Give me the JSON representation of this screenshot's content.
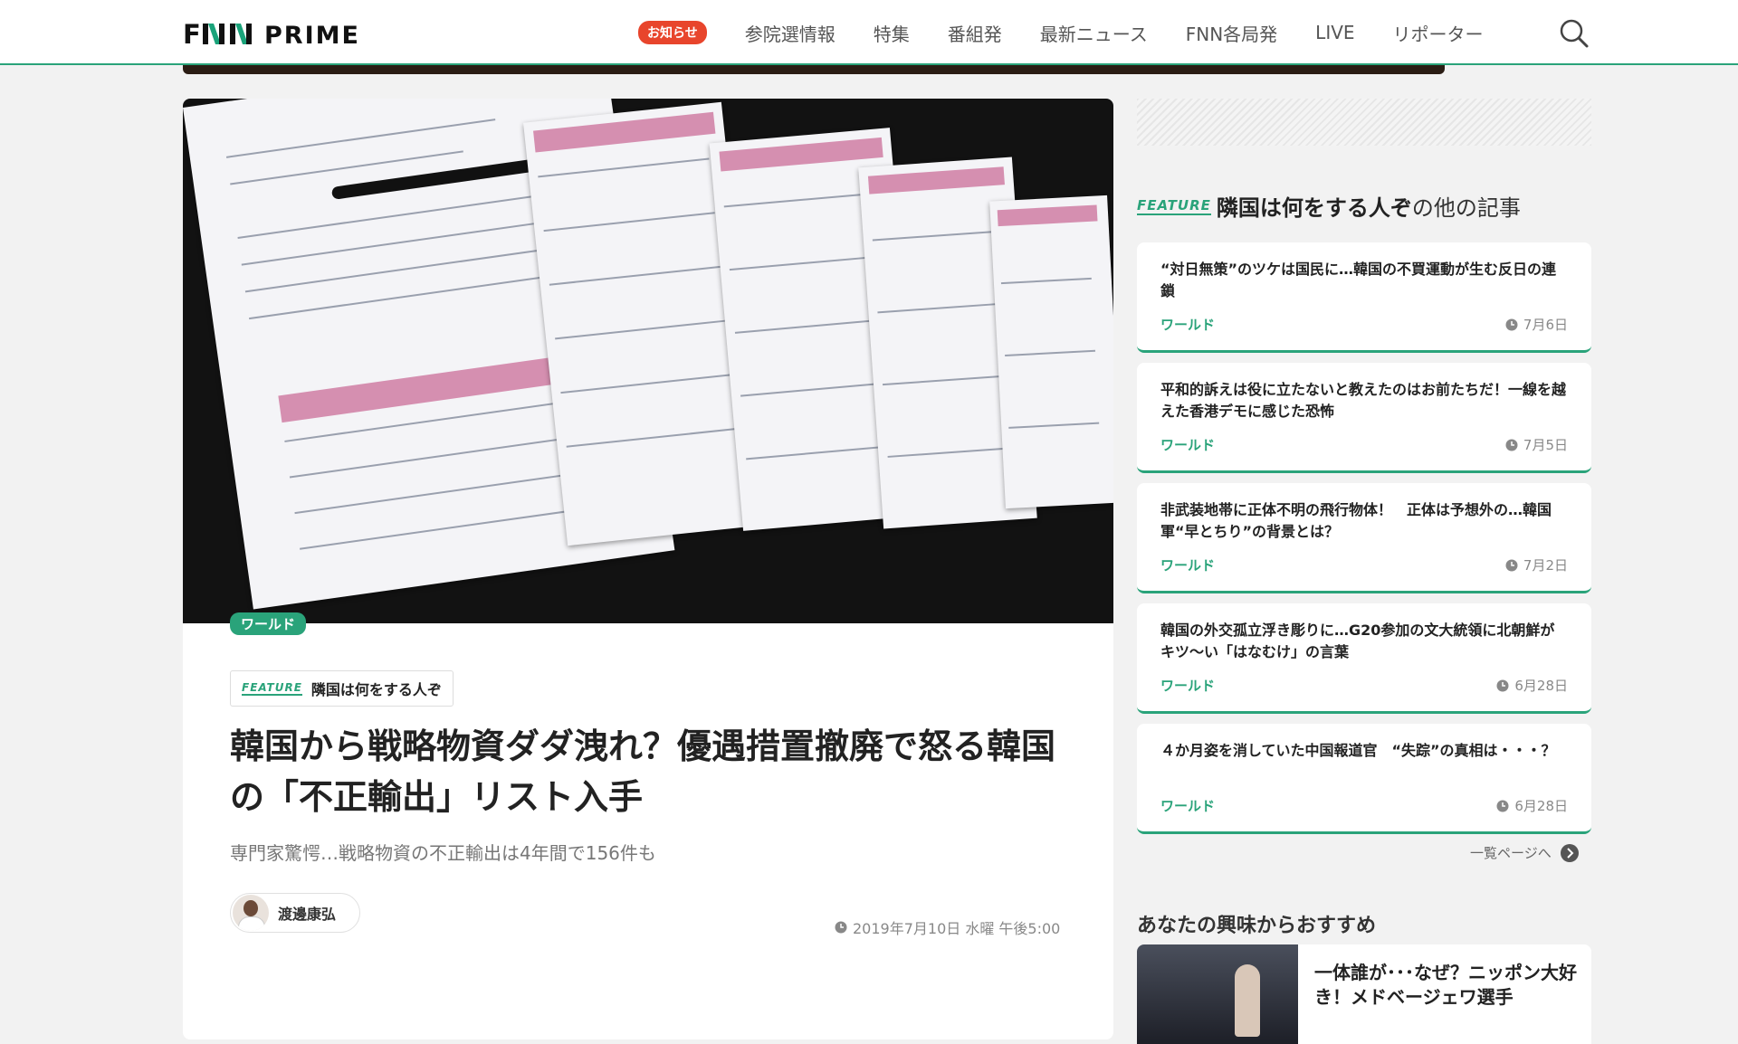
{
  "header": {
    "logo": "FNN PRIME",
    "notice_badge": "お知らせ",
    "nav": [
      "参院選情報",
      "特集",
      "番組発",
      "最新ニュース",
      "FNN各局発",
      "LIVE",
      "リポーター"
    ],
    "search_icon": "search-icon"
  },
  "article": {
    "category": "ワールド",
    "feature_label": "FEATURE",
    "feature_name": "隣国は何をする人ぞ",
    "title": "韓国から戦略物資ダダ洩れ？優遇措置撤廃で怒る韓国の「不正輸出」リスト入手",
    "subtitle": "専門家驚愕…戦略物資の不正輸出は4年間で156件も",
    "author": "渡邊康弘",
    "date": "2019年7月10日 水曜 午後5:00"
  },
  "sidebar": {
    "feature_label": "FEATURE",
    "feature_name": "隣国は何をする人ぞ",
    "feature_suffix": "の他の記事",
    "items": [
      {
        "title": "“対日無策”のツケは国民に…韓国の不買運動が生む反日の連鎖",
        "category": "ワールド",
        "date": "7月6日"
      },
      {
        "title": "平和的訴えは役に立たないと教えたのはお前たちだ！一線を越えた香港デモに感じた恐怖",
        "category": "ワールド",
        "date": "7月5日"
      },
      {
        "title": "非武装地帯に正体不明の飛行物体！　正体は予想外の…韓国軍“早とちり”の背景とは？",
        "category": "ワールド",
        "date": "7月2日"
      },
      {
        "title": "韓国の外交孤立浮き彫りに…G20参加の文大統領に北朝鮮がキツ〜い「はなむけ」の言葉",
        "category": "ワールド",
        "date": "6月28日"
      },
      {
        "title": "４か月姿を消していた中国報道官　“失踪”の真相は・・・？",
        "category": "ワールド",
        "date": "6月28日"
      }
    ],
    "more_link": "一覧ページへ",
    "reco_heading": "あなたの興味からおすすめ",
    "reco_title": "一体誰が･･･なぜ？ニッポン大好き！メドベージェワ選手"
  },
  "colors": {
    "accent": "#2aa37a",
    "notice": "#e8452c",
    "header_bar": "#2b1d14"
  }
}
